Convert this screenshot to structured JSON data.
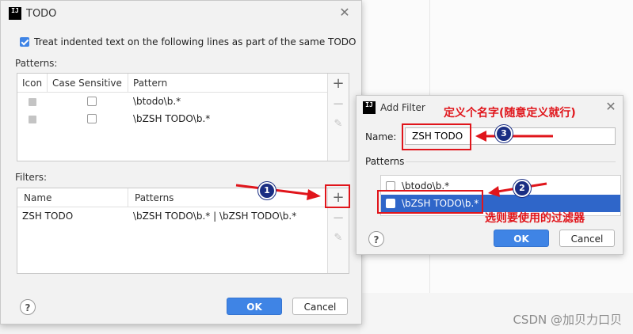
{
  "todo_dialog": {
    "title": "TODO",
    "treat_indented_label": "Treat indented text on the following lines as part of the same TODO",
    "patterns_label": "Patterns:",
    "patterns_columns": [
      "Icon",
      "Case Sensitive",
      "Pattern"
    ],
    "patterns_rows": [
      {
        "pattern": "\\btodo\\b.*"
      },
      {
        "pattern": "\\bZSH TODO\\b.*"
      }
    ],
    "filters_label": "Filters:",
    "filters_columns": [
      "Name",
      "Patterns"
    ],
    "filters_rows": [
      {
        "name": "ZSH TODO",
        "patterns": "\\bZSH TODO\\b.* | \\bZSH TODO\\b.*"
      }
    ],
    "ok_label": "OK",
    "cancel_label": "Cancel",
    "help_label": "?"
  },
  "add_filter_dialog": {
    "title": "Add Filter",
    "name_label": "Name:",
    "name_value": "ZSH TODO",
    "patterns_label": "Patterns",
    "pattern_items": [
      {
        "label": "\\btodo\\b.*",
        "checked": false
      },
      {
        "label": "\\bZSH TODO\\b.*",
        "checked": true
      }
    ],
    "ok_label": "OK",
    "cancel_label": "Cancel",
    "help_label": "?"
  },
  "annotations": {
    "name_hint": "定义个名字(随意定义就行)",
    "select_hint": "选则要使用的过滤器",
    "badge1": "1",
    "badge2": "2",
    "badge3": "3"
  },
  "icons": {
    "app": "intellij-icon",
    "close": "close-icon",
    "add": "plus-icon",
    "remove": "minus-icon",
    "edit": "pencil-icon",
    "help": "help-icon"
  },
  "colors": {
    "accent": "#3f84e5",
    "annotation_red": "#e0151b",
    "badge": "#1a2e83"
  },
  "watermark": "CSDN @加贝力口贝"
}
